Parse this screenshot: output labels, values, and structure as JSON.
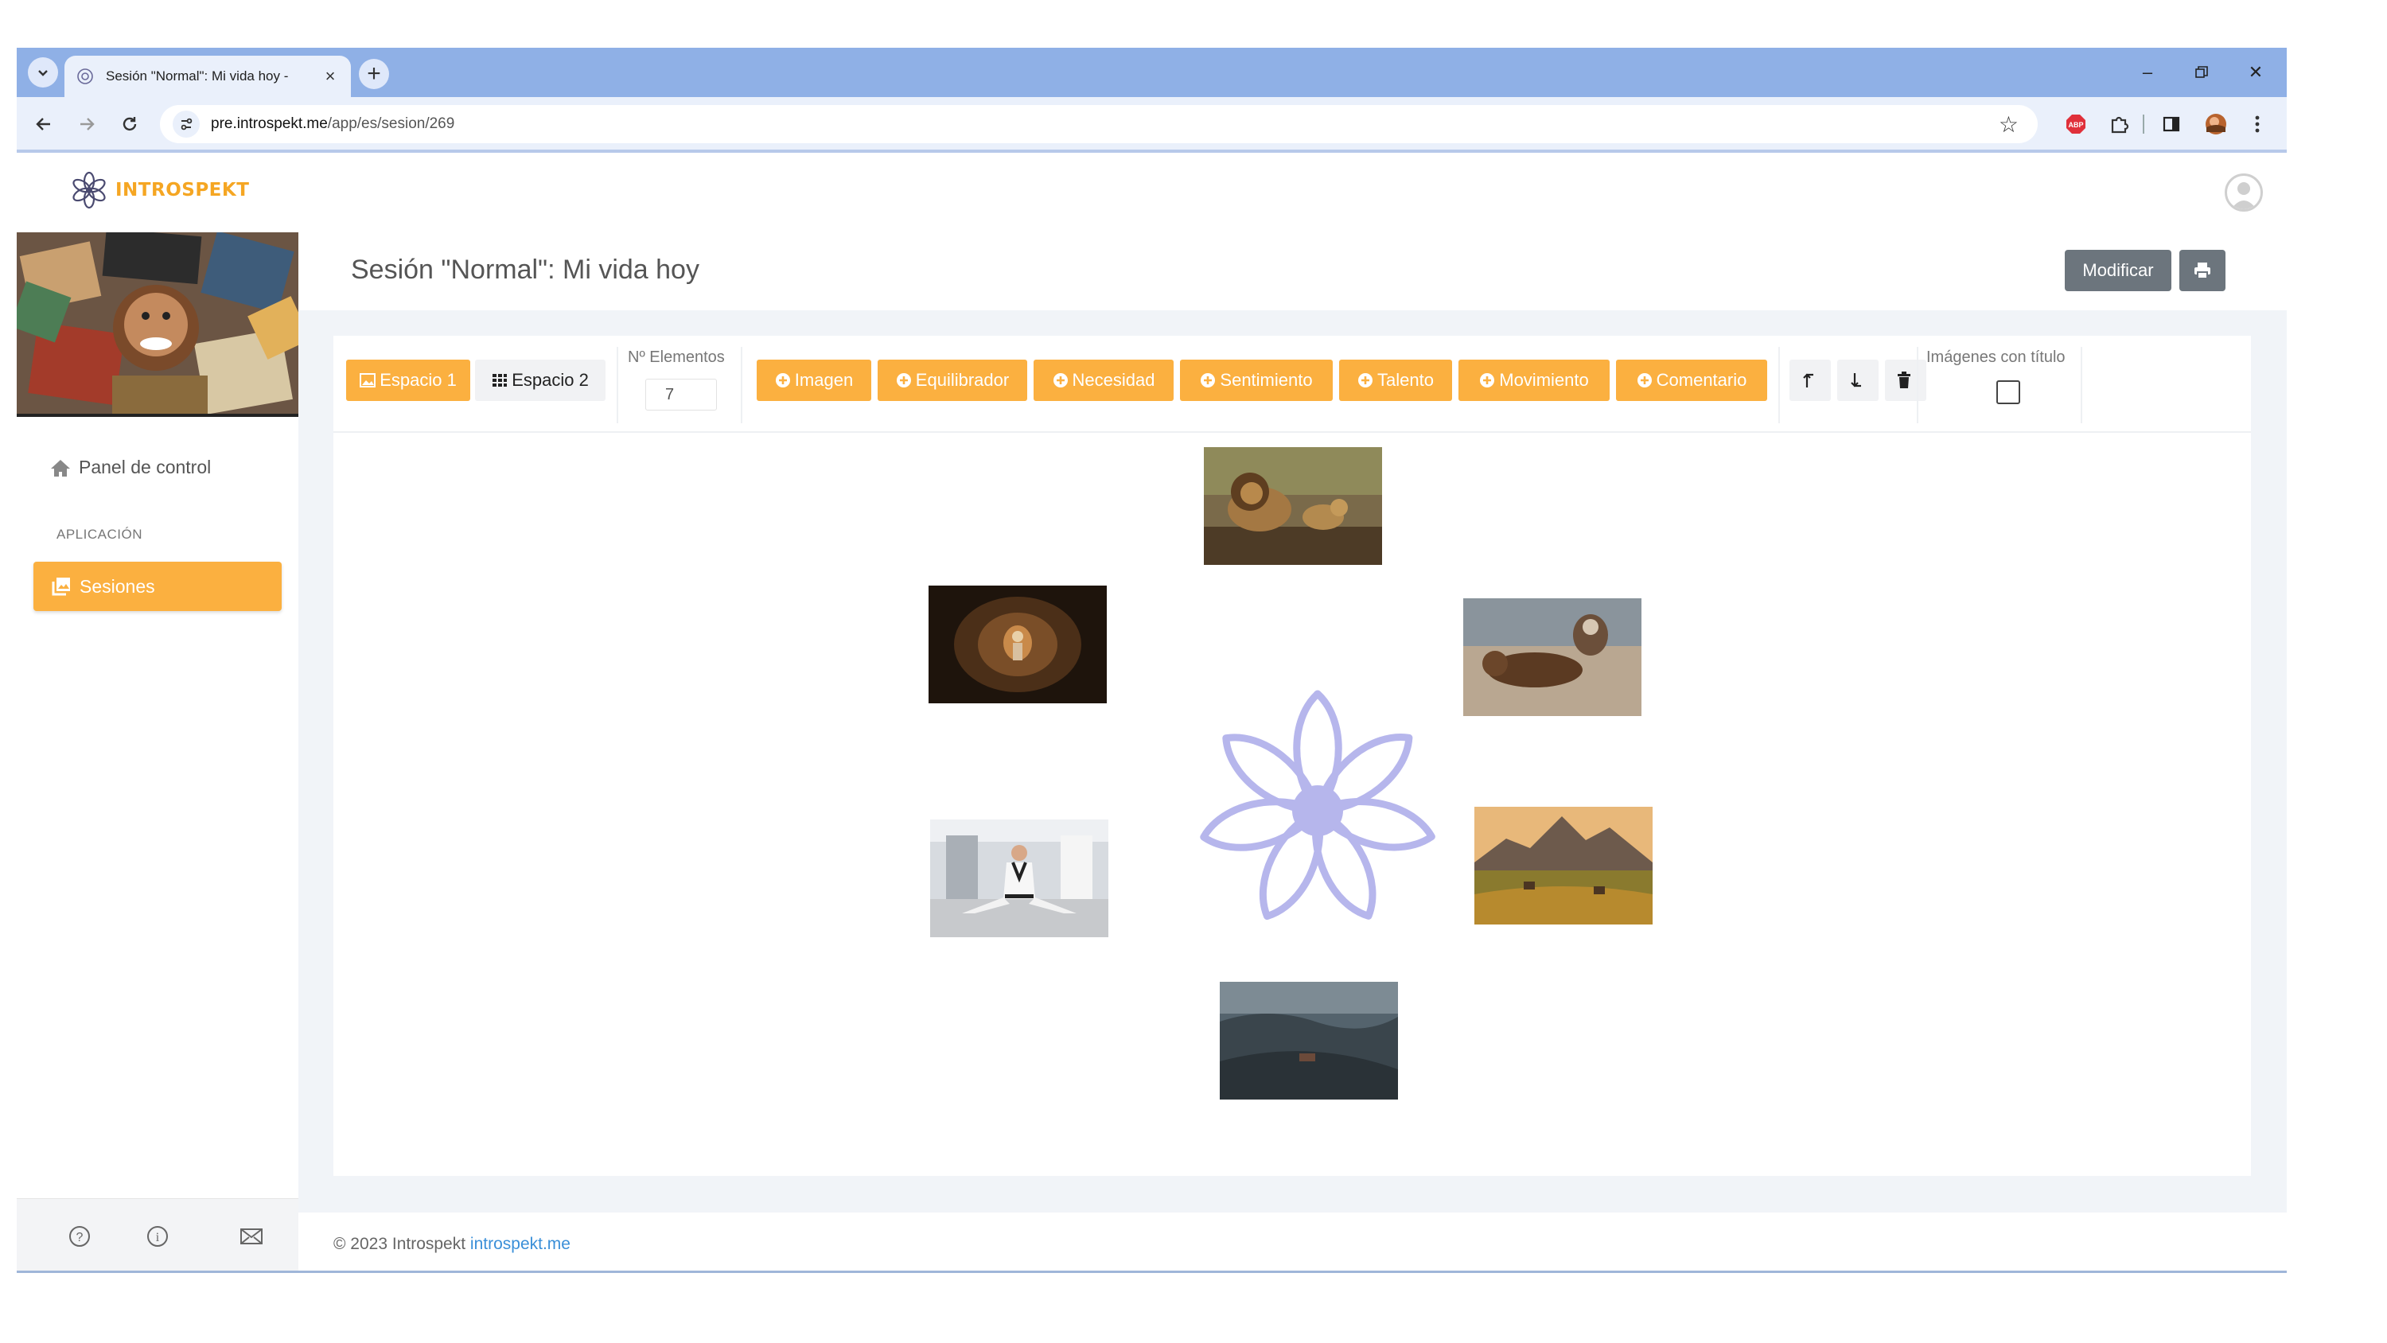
{
  "browser": {
    "tab_title": "Sesión \"Normal\": Mi vida hoy - ",
    "url_host": "pre.introspekt.me",
    "url_path": "/app/es/sesion/269"
  },
  "app": {
    "logo_text": "INTROSPEKT"
  },
  "sidebar": {
    "dashboard_label": "Panel de control",
    "section_label": "APLICACIÓN",
    "sessions_label": "Sesiones"
  },
  "page": {
    "title": "Sesión \"Normal\": Mi vida hoy",
    "modify_button": "Modificar"
  },
  "toolbar": {
    "space1": "Espacio 1",
    "space2": "Espacio 2",
    "elements_label": "Nº Elementos",
    "elements_value": "7",
    "add_image": "Imagen",
    "add_equilibrador": "Equilibrador",
    "add_necesidad": "Necesidad",
    "add_sentimiento": "Sentimiento",
    "add_talento": "Talento",
    "add_movimiento": "Movimiento",
    "add_comentario": "Comentario",
    "images_with_title_label": "Imágenes con título",
    "images_with_title_checked": false
  },
  "canvas": {
    "center_symbol": "introspekt-flower-icon",
    "images": [
      "lions",
      "cave-explorer",
      "otter",
      "martial-artist",
      "mountain-meadow",
      "black-sand-landscape"
    ]
  },
  "footer": {
    "copyright": "© 2023 Introspekt ",
    "link": "introspekt.me"
  },
  "colors": {
    "accent": "#fbb040",
    "logo": "#f5a623",
    "secondary_button": "#6c757d",
    "tabstrip": "#8fb0e6",
    "mandala": "#b6b6ec"
  }
}
